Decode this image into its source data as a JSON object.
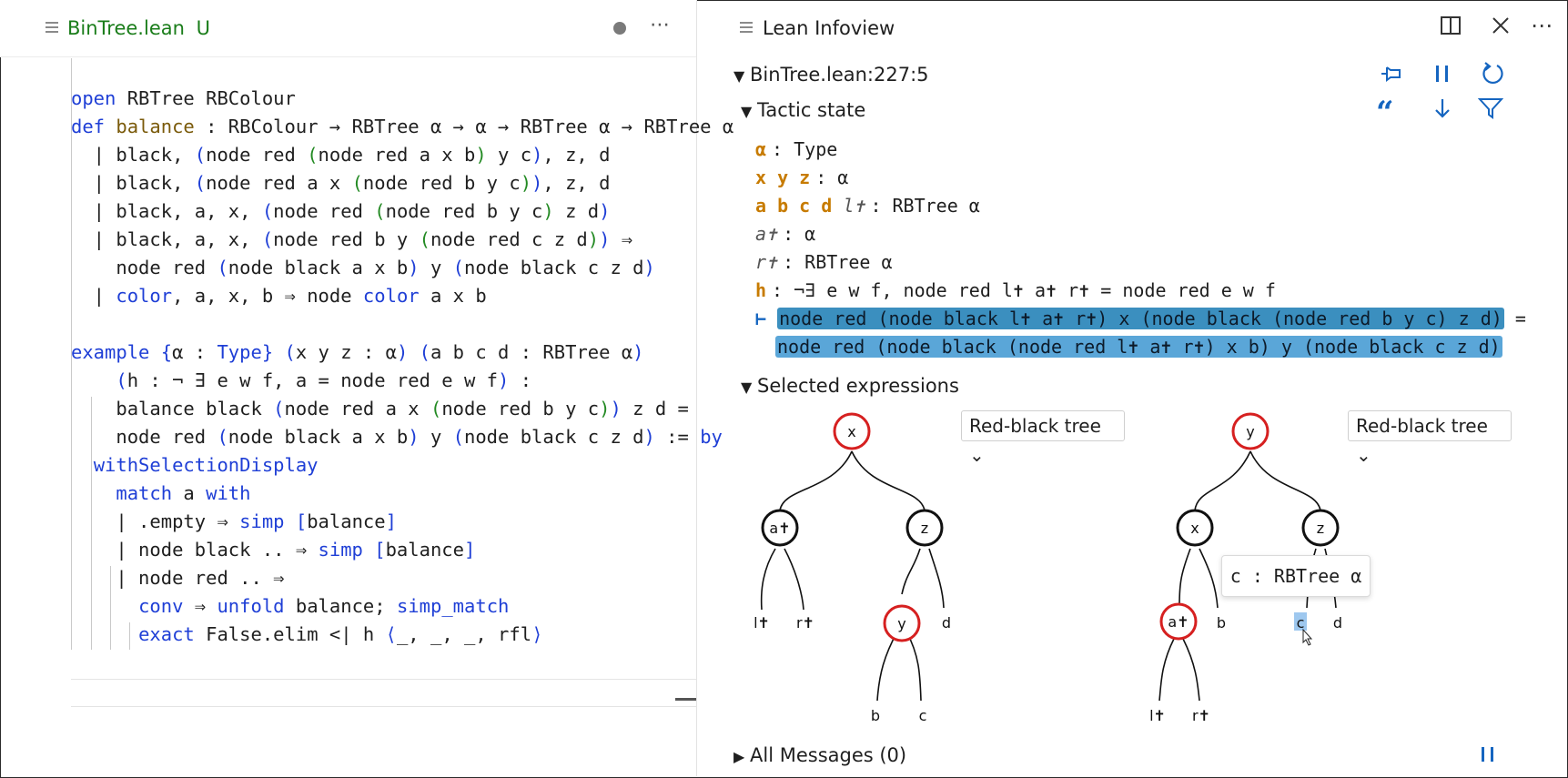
{
  "editor": {
    "tab_title": "BinTree.lean",
    "tab_status": "U",
    "more_label": "⋯",
    "lines": [
      "",
      "open RBTree RBColour",
      "def balance : RBColour → RBTree α → α → RBTree α → RBTree α",
      "  | black, (node red (node red a x b) y c), z, d",
      "  | black, (node red a x (node red b y c)), z, d",
      "  | black, a, x, (node red (node red b y c) z d)",
      "  | black, a, x, (node red b y (node red c z d)) ⇒",
      "    node red (node black a x b) y (node black c z d)",
      "  | color, a, x, b ⇒ node color a x b",
      "",
      "example {α : Type} (x y z : α) (a b c d : RBTree α)",
      "    (h : ¬ ∃ e w f, a = node red e w f) :",
      "    balance black (node red a x (node red b y c)) z d =",
      "    node red (node black a x b) y (node black c z d) := by",
      "  withSelectionDisplay",
      "    match a with",
      "    | .empty ⇒ simp [balance]",
      "    | node black .. ⇒ simp [balance]",
      "    | node red .. ⇒",
      "      conv ⇒ unfold balance; simp_match",
      "      exact False.elim <| h ⟨_, _, _, rfl⟩"
    ]
  },
  "infoview": {
    "title": "Lean Infoview",
    "location": "BinTree.lean:227:5",
    "tactic_state_label": "Tactic state",
    "hypotheses": [
      {
        "names": "α",
        "type": ": Type"
      },
      {
        "names": "x y z",
        "type": ": α"
      },
      {
        "names": "a b c d",
        "inacc": "l✝",
        "type": ": RBTree α"
      },
      {
        "inacc": "a✝",
        "type": ": α"
      },
      {
        "inacc": "r✝",
        "type": ": RBTree α"
      },
      {
        "names": "h",
        "type": ": ¬∃ e w f, node red l✝ a✝ r✝ = node red e w f"
      }
    ],
    "goal_turnstile": "⊢",
    "goal_lhs": "node red (node black l✝ a✝ r✝) x (node black (node red b y c) z d)",
    "goal_eq": " =",
    "goal_rhs": "node red (node black (node red l✝ a✝ r✝) x b) y (node black c z d)",
    "selected_label": "Selected expressions",
    "display_select_1": "Red-black tree",
    "display_select_2": "Red-black tree",
    "tooltip": "c : RBTree α",
    "all_messages": "All Messages (0)",
    "tree_labels": {
      "t1_root": "x",
      "t1_left": "a✝",
      "t1_right": "z",
      "t1_ll": "l✝",
      "t1_lr": "r✝",
      "t1_rl": "y",
      "t1_rr": "d",
      "t1_rll": "b",
      "t1_rlr": "c",
      "t2_root": "y",
      "t2_left": "x",
      "t2_right": "z",
      "t2_ll": "a✝",
      "t2_lr": "b",
      "t2_rl": "c",
      "t2_rr": "d",
      "t2_lll": "l✝",
      "t2_llr": "r✝"
    }
  },
  "colors": {
    "red_node": "#d62020",
    "black_node": "#111111",
    "accent": "#1565c0",
    "highlight": "#5aa6d8"
  }
}
